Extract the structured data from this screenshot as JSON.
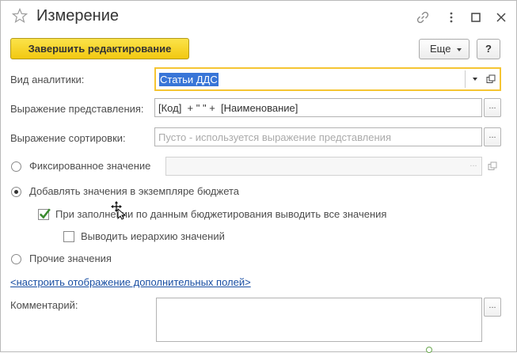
{
  "window": {
    "title": "Измерение",
    "icons": [
      "star-icon",
      "link-icon",
      "more-vert-icon",
      "maximize-icon",
      "close-icon"
    ]
  },
  "toolbar": {
    "finish_label": "Завершить редактирование",
    "more_label": "Еще",
    "help_label": "?"
  },
  "form": {
    "analytics_type": {
      "label": "Вид аналитики:",
      "value": "Статьи ДДС"
    },
    "representation": {
      "label": "Выражение представления:",
      "value": "[Код]  + \" \" +  [Наименование]"
    },
    "sorting": {
      "label": "Выражение сортировки:",
      "placeholder": "Пусто - используется выражение представления"
    },
    "fixed_value": {
      "label": "Фиксированное значение",
      "selected": false
    },
    "add_values": {
      "label": "Добавлять значения в экземпляре бюджета",
      "selected": true
    },
    "output_all": {
      "label": "При заполнении по данным бюджетирования выводить все значения",
      "checked": true
    },
    "hierarchy": {
      "label": "Выводить иерархию значений",
      "checked": false
    },
    "other_values": {
      "label": "Прочие значения",
      "selected": false
    },
    "configure_link": "<настроить отображение дополнительных полей>",
    "comment": {
      "label": "Комментарий:",
      "value": ""
    }
  },
  "colors": {
    "accent_yellow": "#f2c811",
    "focus_border": "#f5c533",
    "selection_blue": "#3875d7",
    "link_blue": "#1a4fa3",
    "check_green": "#3a8a2e"
  }
}
